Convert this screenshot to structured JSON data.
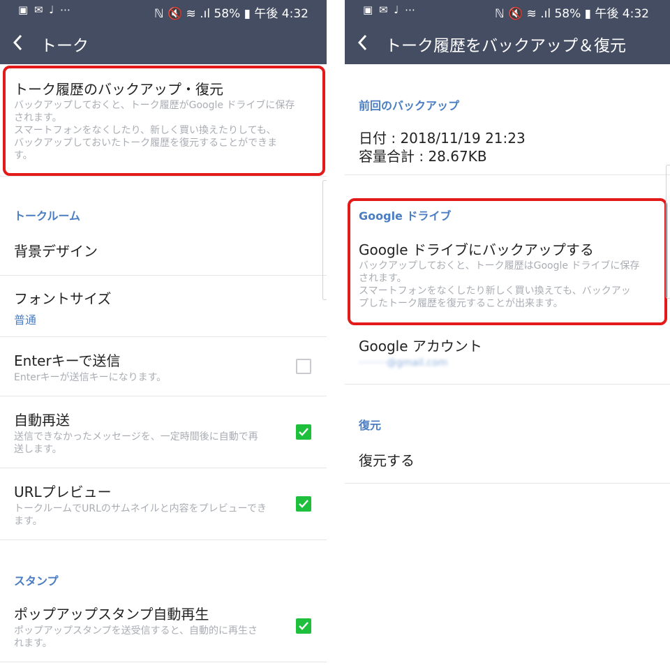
{
  "status_bar": {
    "left_icons": [
      "image-icon",
      "mail-icon",
      "mic-icon",
      "more-icon"
    ],
    "left_glyphs": "▣ ✉ ♩ ⋯",
    "right_text": "ℕ 🔇 ≋ .ıl 58% ▮ 午後 4:32"
  },
  "left": {
    "title": "トーク",
    "backup": {
      "title": "トーク履歴のバックアップ・復元",
      "desc_line1": "バックアップしておくと、トーク履歴がGoogle ドライブに保存",
      "desc_line2": "されます。",
      "desc_line3": "スマートフォンをなくしたり、新しく買い換えたりしても、",
      "desc_line4": "バックアップしておいたトーク履歴を復元することができま",
      "desc_line5": "す。"
    },
    "section_talkroom": "トークルーム",
    "bg_design": "背景デザイン",
    "font_size": {
      "title": "フォントサイズ",
      "value": "普通"
    },
    "enter_send": {
      "title": "Enterキーで送信",
      "desc": "Enterキーが送信キーになります。",
      "checked": false
    },
    "auto_resend": {
      "title": "自動再送",
      "desc_line1": "送信できなかったメッセージを、一定時間後に自動で再",
      "desc_line2": "送します。",
      "checked": true
    },
    "url_preview": {
      "title": "URLプレビュー",
      "desc_line1": "トークルームでURLのサムネイルと内容をプレビューでき",
      "desc_line2": "ます。",
      "checked": true
    },
    "section_stamp": "スタンプ",
    "popup_stamp": {
      "title": "ポップアップスタンプ自動再生",
      "desc_line1": "ポップアップスタンプを送受信すると、自動的に再生さ",
      "desc_line2": "れます。",
      "checked": true
    }
  },
  "right": {
    "title": "トーク履歴をバックアップ＆復元",
    "section_last_backup": "前回のバックアップ",
    "date_line": "日付 : 2018/11/19 21:23",
    "size_line": "容量合計 : 28.67KB",
    "section_gdrive": "Google ドライブ",
    "gdrive_backup": {
      "title": "Google ドライブにバックアップする",
      "desc_line1": "バックアップしておくと、トーク履歴はGoogle ドライブに保存",
      "desc_line2": "されます。",
      "desc_line3": "スマートフォンをなくしたり新しく買い換えても、バックアッ",
      "desc_line4": "プしたトーク履歴を復元することが出来ます。"
    },
    "google_account": {
      "title": "Google アカウント",
      "value": "·········@gmail.com"
    },
    "section_restore": "復元",
    "restore": "復元する"
  },
  "colors": {
    "header_bg": "#454d63",
    "section_blue": "#4a7dc2",
    "highlight_red": "#e21a1a",
    "checkbox_green": "#1fbf3e"
  }
}
